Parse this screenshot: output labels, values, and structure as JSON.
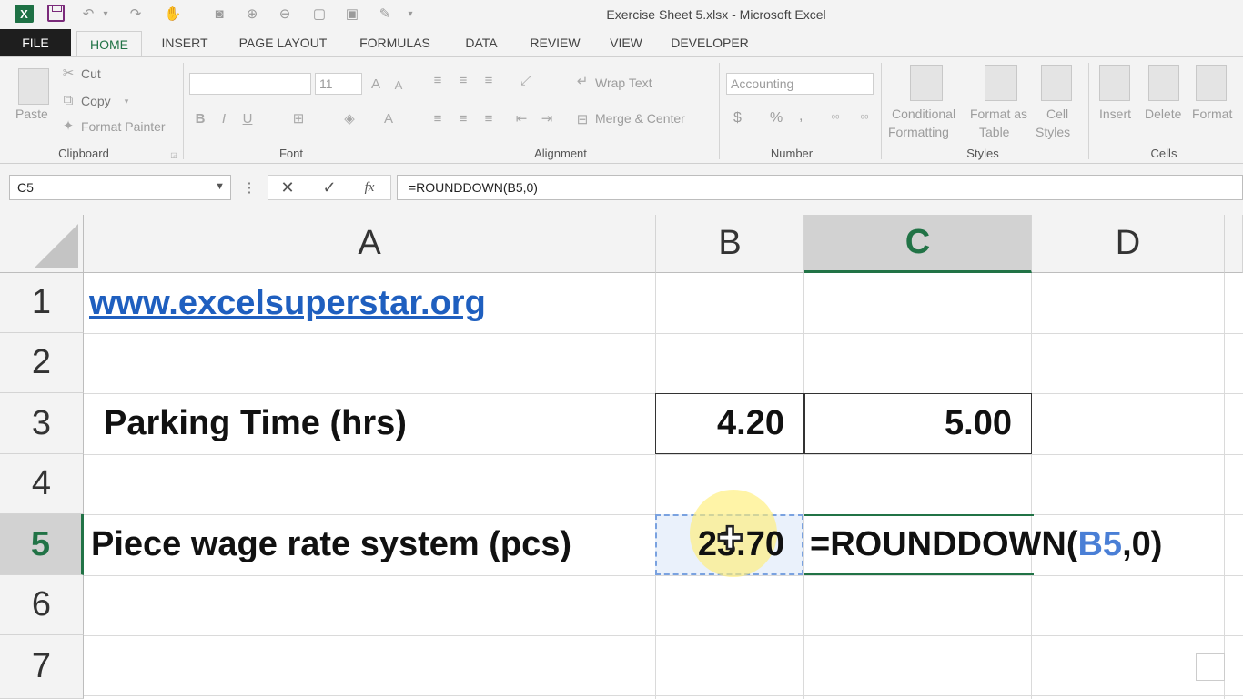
{
  "window": {
    "title": "Exercise Sheet 5.xlsx - Microsoft Excel",
    "app_icon": "X"
  },
  "tabs": [
    "FILE",
    "HOME",
    "INSERT",
    "PAGE LAYOUT",
    "FORMULAS",
    "DATA",
    "REVIEW",
    "VIEW",
    "DEVELOPER"
  ],
  "ribbon": {
    "clipboard": {
      "paste": "Paste",
      "cut": "Cut",
      "copy": "Copy",
      "format_painter": "Format Painter",
      "label": "Clipboard"
    },
    "font": {
      "size": "11",
      "label": "Font",
      "bold": "B",
      "italic": "I",
      "underline": "U"
    },
    "alignment": {
      "wrap_text": "Wrap Text",
      "merge_center": "Merge & Center",
      "label": "Alignment"
    },
    "number": {
      "format": "Accounting",
      "currency": "$",
      "percent": "%",
      "comma": ",",
      "label": "Number"
    },
    "styles": {
      "conditional1": "Conditional",
      "conditional2": "Formatting",
      "format_as1": "Format as",
      "format_as2": "Table",
      "cell1": "Cell",
      "cell2": "Styles",
      "label": "Styles"
    },
    "cells": {
      "insert": "Insert",
      "delete": "Delete",
      "format": "Format",
      "label": "Cells"
    }
  },
  "formula_bar": {
    "name_box": "C5",
    "formula": "=ROUNDDOWN(B5,0)"
  },
  "columns": [
    {
      "label": "A",
      "selected": false
    },
    {
      "label": "B",
      "selected": false
    },
    {
      "label": "C",
      "selected": true
    },
    {
      "label": "D",
      "selected": false
    }
  ],
  "rows": [
    {
      "label": "1",
      "selected": false
    },
    {
      "label": "2",
      "selected": false
    },
    {
      "label": "3",
      "selected": false
    },
    {
      "label": "4",
      "selected": false
    },
    {
      "label": "5",
      "selected": true
    },
    {
      "label": "6",
      "selected": false
    },
    {
      "label": "7",
      "selected": false
    }
  ],
  "cells": {
    "A1": "www.excelsuperstar.org",
    "A3": "Parking Time (hrs)",
    "B3": "4.20",
    "C3": "5.00",
    "A5": "Piece wage rate system (pcs)",
    "B5": "23.70",
    "C5_prefix": "=ROUNDDOWN(",
    "C5_ref": "B5",
    "C5_suffix": ",0)"
  },
  "colors": {
    "accent": "#217346",
    "link": "#1f5fbf",
    "ref": "#4a7fd6"
  }
}
